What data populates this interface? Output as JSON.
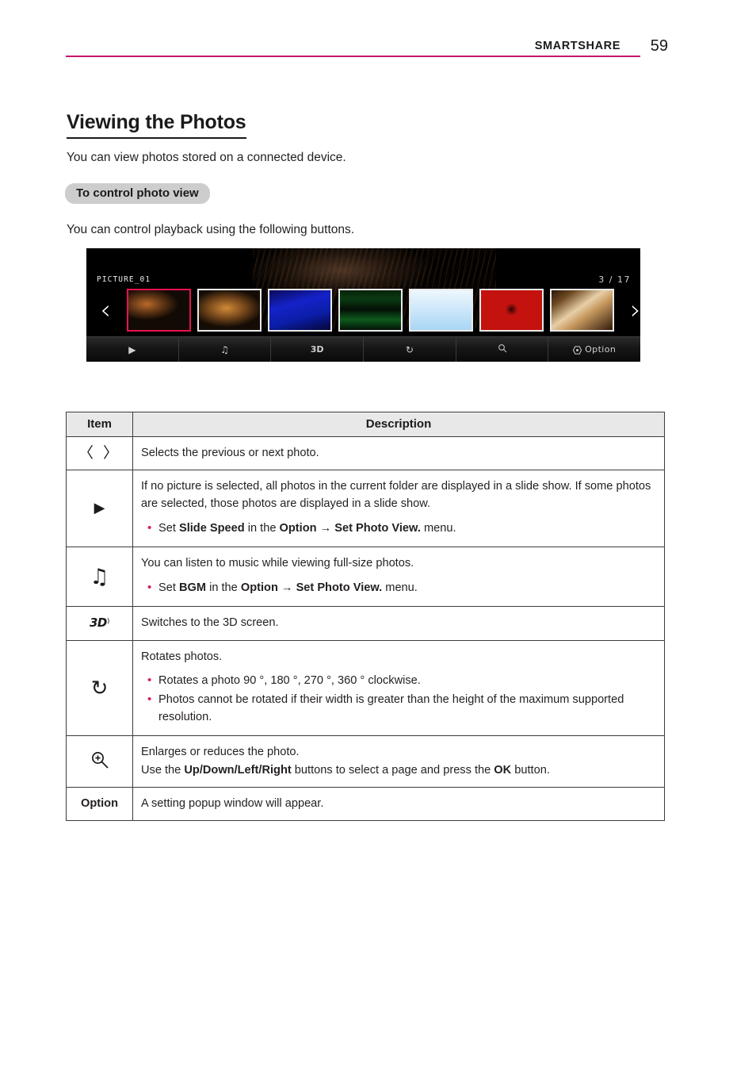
{
  "header": {
    "title": "SMARTSHARE",
    "page_number": "59",
    "rule_color": "#c4186a"
  },
  "section": {
    "title": "Viewing the Photos",
    "intro": "You can view photos stored on a connected device.",
    "subsection_badge": "To control photo view",
    "lead": "You can control playback using the following buttons."
  },
  "screenshot": {
    "filename": "PICTURE_01",
    "counter": "3 / 17",
    "prev_arrow": "‹",
    "next_arrow": "›",
    "selected_thumbnail_index": 1,
    "selection_border_color": "#e8114f",
    "thumbnails": [
      {
        "name": "thumb-rock-sunset"
      },
      {
        "name": "thumb-rock-cliff"
      },
      {
        "name": "thumb-blue-gradient"
      },
      {
        "name": "thumb-green-field"
      },
      {
        "name": "thumb-light-blue-sky"
      },
      {
        "name": "thumb-red-pomegranate"
      },
      {
        "name": "thumb-cream-closeup"
      }
    ],
    "toolbar": [
      {
        "icon": "play-icon",
        "glyph": "▶",
        "label": ""
      },
      {
        "icon": "music-note-icon",
        "glyph": "♫",
        "label": ""
      },
      {
        "icon": "three-d-icon",
        "glyph": "3D",
        "label": ""
      },
      {
        "icon": "rotate-icon",
        "glyph": "↻",
        "label": ""
      },
      {
        "icon": "magnifier-icon",
        "glyph": "⊕",
        "label": ""
      },
      {
        "icon": "option-gear-icon",
        "glyph": "",
        "label": "Option"
      }
    ]
  },
  "table": {
    "headers": {
      "item": "Item",
      "description": "Description"
    },
    "rows": [
      {
        "item_icon": "prev-next-arrows-icon",
        "item_glyph": "〈 〉",
        "desc_main": "Selects the previous or next photo.",
        "bullets": []
      },
      {
        "item_icon": "play-icon",
        "item_glyph": "▶",
        "desc_main": "If no picture is selected, all photos in the current folder are displayed in a slide show. If some photos are selected, those photos are displayed in a slide show.",
        "bullets": [
          {
            "parts": [
              {
                "t": "Set ",
                "b": false
              },
              {
                "t": "Slide Speed",
                "b": true
              },
              {
                "t": " in the ",
                "b": false
              },
              {
                "t": "Option",
                "b": true
              },
              {
                "t": "  → ",
                "b": false
              },
              {
                "t": "Set Photo View.",
                "b": true
              },
              {
                "t": " menu.",
                "b": false
              }
            ]
          }
        ]
      },
      {
        "item_icon": "music-note-icon",
        "item_glyph": "♫",
        "desc_main": "You can listen to music while viewing full-size photos.",
        "bullets": [
          {
            "parts": [
              {
                "t": "Set ",
                "b": false
              },
              {
                "t": "BGM",
                "b": true
              },
              {
                "t": " in the ",
                "b": false
              },
              {
                "t": "Option",
                "b": true
              },
              {
                "t": " → ",
                "b": false
              },
              {
                "t": "Set Photo View.",
                "b": true
              },
              {
                "t": " menu.",
                "b": false
              }
            ]
          }
        ]
      },
      {
        "item_icon": "three-d-icon",
        "item_glyph": "3D",
        "desc_main": "Switches to the 3D screen.",
        "bullets": []
      },
      {
        "item_icon": "rotate-icon",
        "item_glyph": "↻",
        "desc_main": "Rotates photos.",
        "bullets": [
          {
            "parts": [
              {
                "t": "Rotates a photo 90 °, 180 °, 270 °, 360 ° clockwise.",
                "b": false
              }
            ]
          },
          {
            "parts": [
              {
                "t": "Photos cannot be rotated if their width is greater than the height of the maximum supported resolution.",
                "b": false
              }
            ]
          }
        ]
      },
      {
        "item_icon": "magnifier-plus-icon",
        "item_glyph": "",
        "desc_main": "Enlarges or reduces the photo.",
        "desc_rich": [
          {
            "t": "Use the ",
            "b": false
          },
          {
            "t": "Up/Down/Left/Right",
            "b": true
          },
          {
            "t": " buttons to select a page and press the ",
            "b": false
          },
          {
            "t": "OK",
            "b": true
          },
          {
            "t": " button.",
            "b": false
          }
        ],
        "bullets": []
      },
      {
        "item_icon": "option-label",
        "item_glyph": "Option",
        "desc_main": "A setting popup window will appear.",
        "bullets": []
      }
    ]
  }
}
